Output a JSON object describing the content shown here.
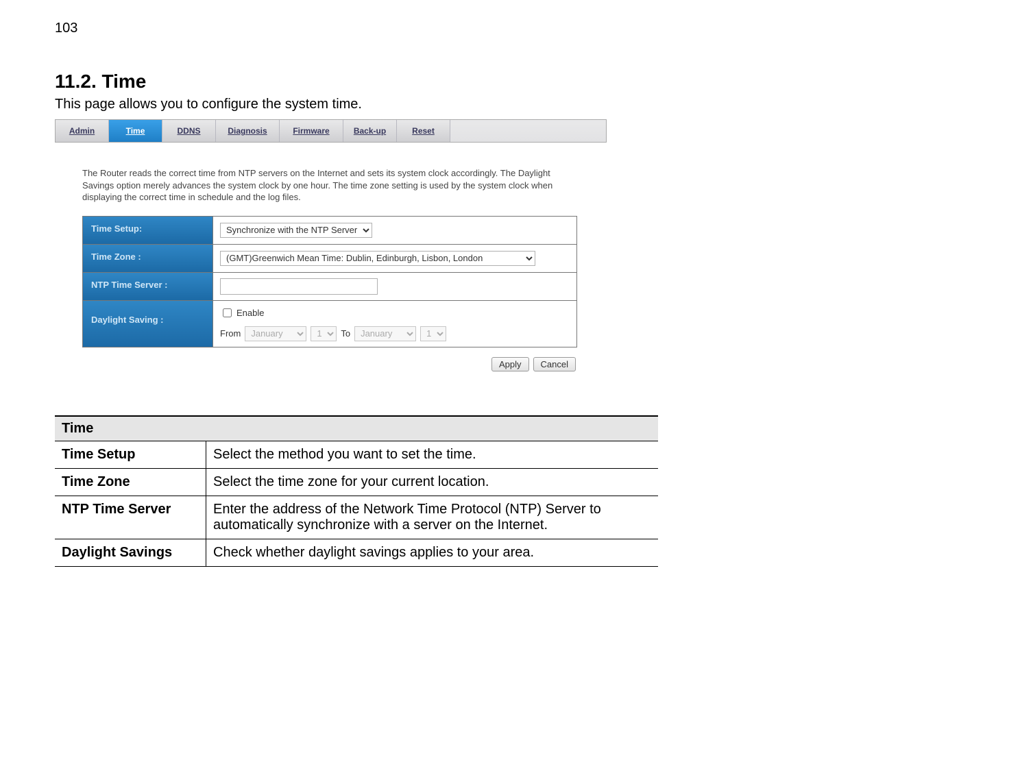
{
  "page_number": "103",
  "heading": "11.2.  Time",
  "heading_desc": "This page allows you to configure the system time.",
  "tabs": {
    "admin": "Admin",
    "time": "Time",
    "ddns": "DDNS",
    "diagnosis": "Diagnosis",
    "firmware": "Firmware",
    "backup": "Back-up",
    "reset": "Reset"
  },
  "intro": "The Router reads the correct time from NTP servers on the Internet and sets its system clock accordingly. The Daylight Savings option merely advances the system clock by one hour. The time zone setting is used by the system clock when displaying the correct time in schedule and the log files.",
  "settings": {
    "time_setup_label": "Time Setup:",
    "time_setup_value": "Synchronize with the NTP Server",
    "time_zone_label": "Time Zone :",
    "time_zone_value": "(GMT)Greenwich Mean Time: Dublin, Edinburgh, Lisbon, London",
    "ntp_label": "NTP Time Server :",
    "ntp_value": "",
    "dst_label": "Daylight Saving :",
    "dst_enable_label": "Enable",
    "dst_enable_checked": false,
    "dst_from_label": "From",
    "dst_from_month": "January",
    "dst_from_day": "1",
    "dst_to_label": "To",
    "dst_to_month": "January",
    "dst_to_day": "1"
  },
  "buttons": {
    "apply": "Apply",
    "cancel": "Cancel"
  },
  "desc_table": {
    "header": "Time",
    "rows": [
      {
        "k": "Time Setup",
        "v": "Select the method you want to set the time."
      },
      {
        "k": "Time Zone",
        "v": "Select the time zone for your current location."
      },
      {
        "k": "NTP Time Server",
        "v": "Enter the address of the Network Time Protocol (NTP) Server to automatically synchronize with a server on the Internet."
      },
      {
        "k": "Daylight Savings",
        "v": "Check whether daylight savings applies to your area."
      }
    ]
  }
}
